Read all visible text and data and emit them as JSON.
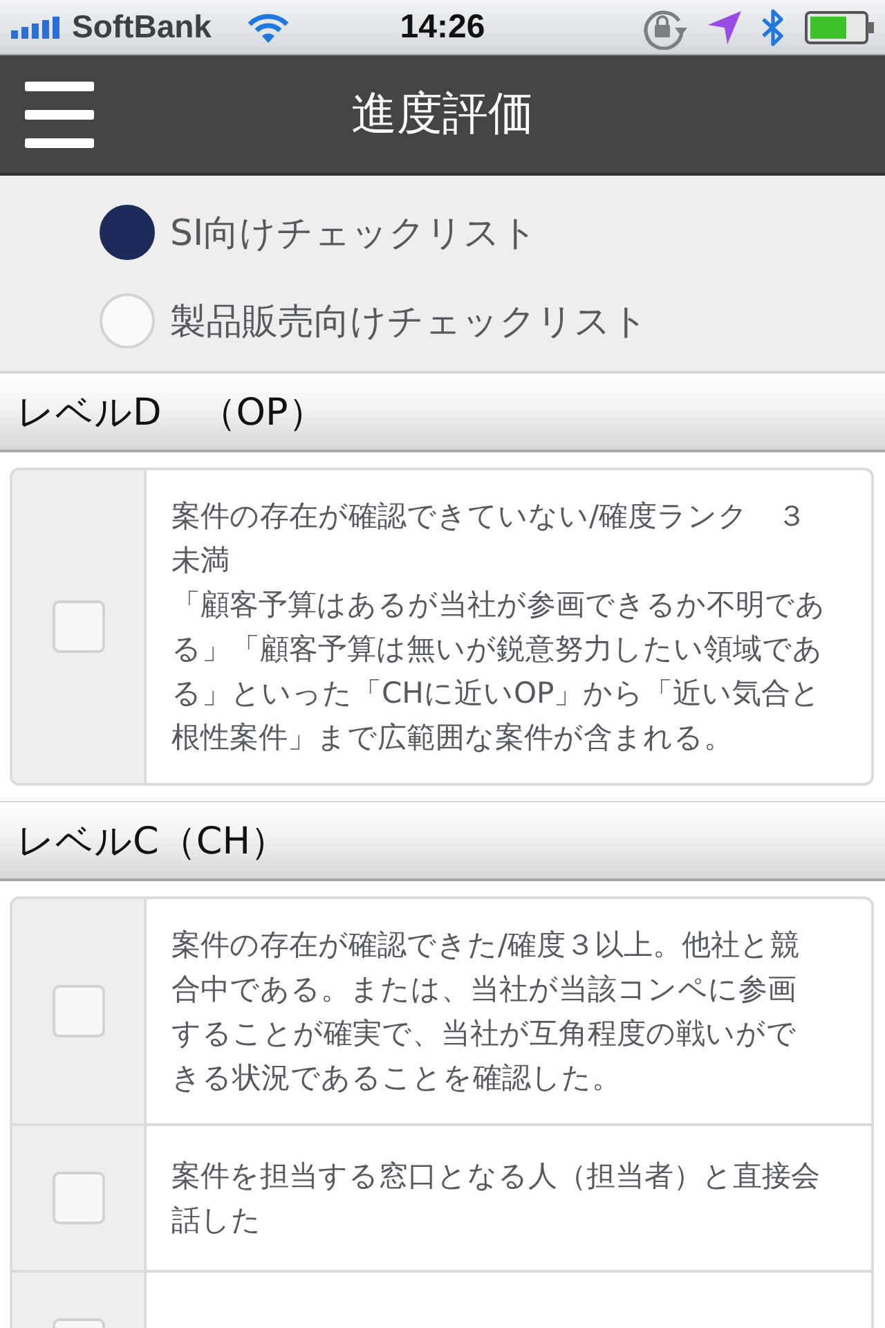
{
  "status_bar": {
    "carrier": "SoftBank",
    "time": "14:26"
  },
  "header": {
    "title": "進度評価"
  },
  "checklist_types": [
    {
      "label": "SI向けチェックリスト",
      "selected": true
    },
    {
      "label": "製品販売向けチェックリスト",
      "selected": false
    }
  ],
  "levels": [
    {
      "title": "レベルD　（OP）",
      "items": [
        {
          "paragraphs": [
            "案件の存在が確認できていない/確度ランク　３未満",
            "「顧客予算はあるが当社が参画できるか不明である」「顧客予算は無いが鋭意努力したい領域である」といった「CHに近いOP」から「近い気合と根性案件」まで広範囲な案件が含まれる。"
          ],
          "checked": false
        }
      ]
    },
    {
      "title": "レベルC（CH）",
      "items": [
        {
          "paragraphs": [
            "案件の存在が確認できた/確度３以上。他社と競合中である。または、当社が当該コンペに参画することが確実で、当社が互角程度の戦いができる状況であることを確認した。"
          ],
          "checked": false
        },
        {
          "paragraphs": [
            "案件を担当する窓口となる人（担当者）と直接会話した"
          ],
          "checked": false
        },
        {
          "checked": false
        }
      ]
    }
  ]
}
